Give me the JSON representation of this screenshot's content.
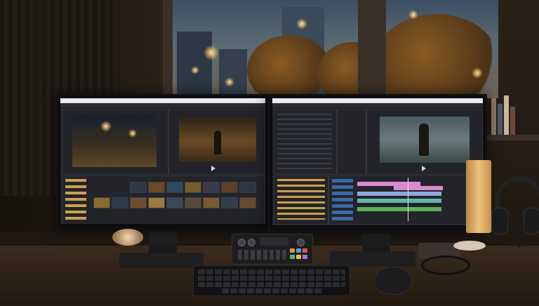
{
  "scene": {
    "elements": [
      "window-view",
      "left-monitor",
      "right-monitor",
      "audio-controller",
      "keyboard",
      "mouse",
      "desk-lamp",
      "headphones"
    ]
  },
  "colors": {
    "warm_light": "#f0c27a",
    "screen_bg": "#1e1f23",
    "window_sky": "#3c4e63",
    "clip_pink": "#d98bd0",
    "clip_teal": "#5fb7a8",
    "clip_green": "#5fae5a",
    "audio_meter": "#56d44e"
  },
  "icons": [
    "play-icon",
    "folder-icon"
  ]
}
